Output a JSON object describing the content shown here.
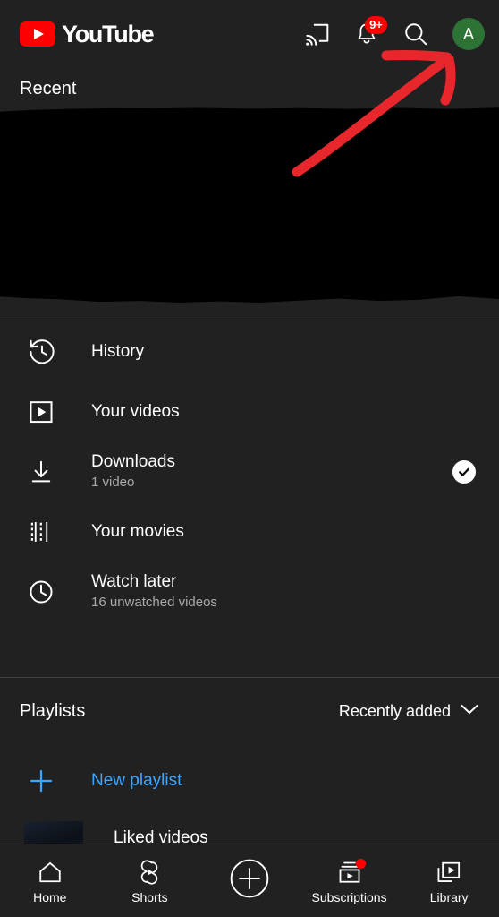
{
  "app": {
    "name": "YouTube",
    "theme_background": "#212121",
    "accent_red": "#ff0000",
    "accent_blue": "#3ea6ff",
    "annotation_color": "#e8272c"
  },
  "header": {
    "logo_text": "YouTube",
    "logo_icon": "youtube-play-badge-icon",
    "actions": [
      {
        "name": "cast-icon",
        "label": "Cast"
      },
      {
        "name": "notifications-bell-icon",
        "label": "Notifications",
        "badge": "9+"
      },
      {
        "name": "search-icon",
        "label": "Search"
      }
    ],
    "avatar": {
      "initial": "A",
      "color": "#2d7335"
    }
  },
  "recent": {
    "section_title": "Recent",
    "redacted": true
  },
  "annotation": {
    "type": "hand-drawn-arrow",
    "points_to": "account-avatar",
    "color": "#e8272c"
  },
  "library_rows": [
    {
      "icon": "history-clock-icon",
      "title": "History",
      "subtitle": "",
      "trailing": ""
    },
    {
      "icon": "your-videos-play-box-icon",
      "title": "Your videos",
      "subtitle": "",
      "trailing": ""
    },
    {
      "icon": "download-arrow-icon",
      "title": "Downloads",
      "subtitle": "1 video",
      "trailing": "check-circle-icon"
    },
    {
      "icon": "film-strip-icon",
      "title": "Your movies",
      "subtitle": "",
      "trailing": ""
    },
    {
      "icon": "clock-icon",
      "title": "Watch later",
      "subtitle": "16 unwatched videos",
      "trailing": ""
    }
  ],
  "playlists": {
    "title": "Playlists",
    "sort_label": "Recently added",
    "sort_icon": "chevron-down-icon",
    "new_playlist_label": "New playlist",
    "new_playlist_icon": "plus-icon",
    "items": [
      {
        "title": "Liked videos",
        "thumbnail": "liked-videos-thumbnail"
      }
    ]
  },
  "bottom_nav": [
    {
      "icon": "home-icon",
      "label": "Home",
      "badge": false
    },
    {
      "icon": "shorts-icon",
      "label": "Shorts",
      "badge": false
    },
    {
      "icon": "create-plus-icon",
      "label": "",
      "badge": false
    },
    {
      "icon": "subscriptions-icon",
      "label": "Subscriptions",
      "badge": true
    },
    {
      "icon": "library-icon",
      "label": "Library",
      "badge": false
    }
  ]
}
